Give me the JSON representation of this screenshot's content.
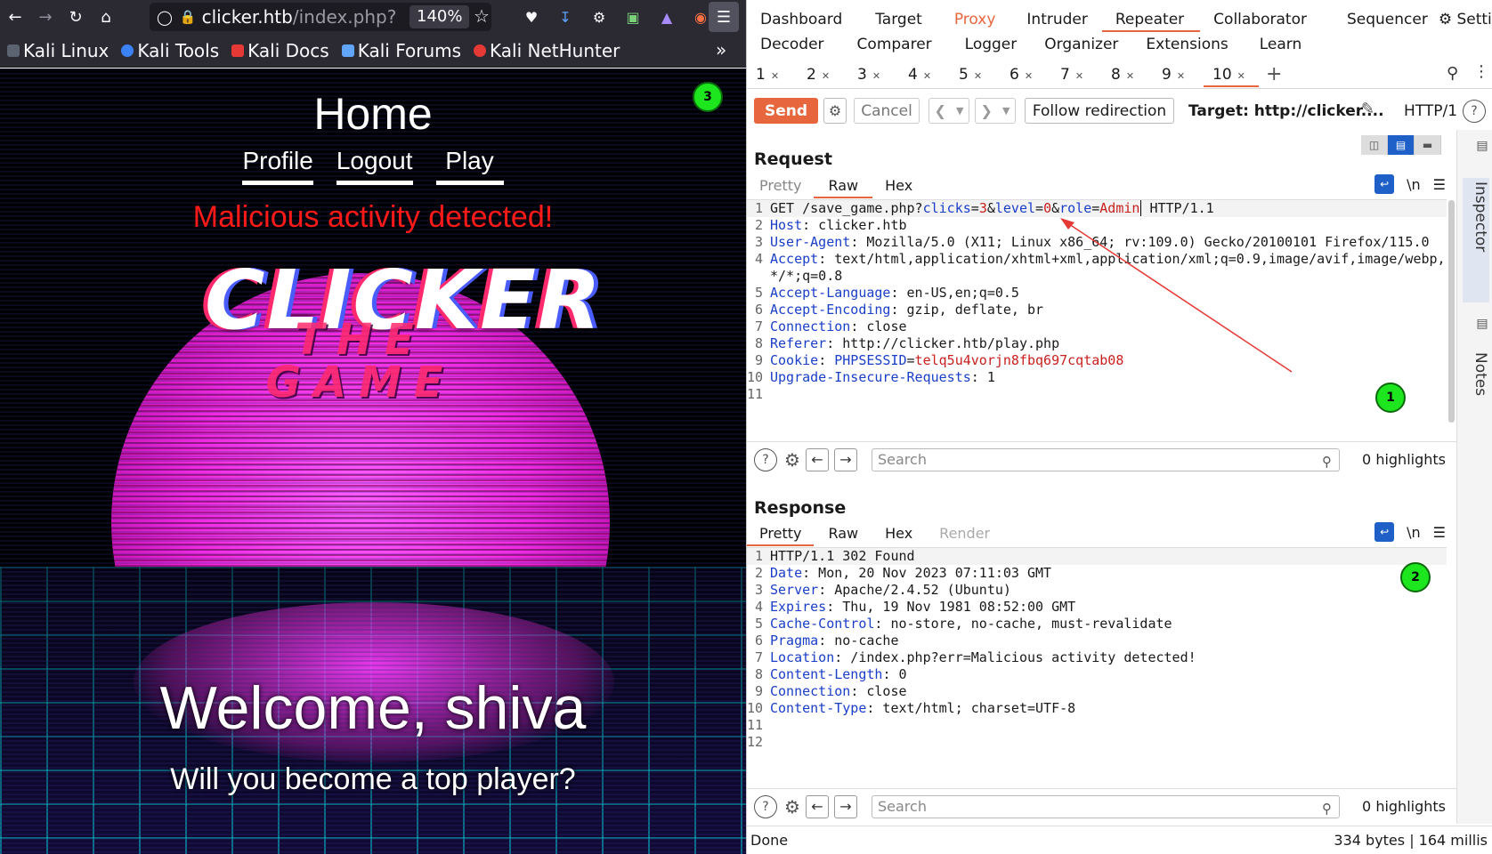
{
  "firefox": {
    "url_host": "clicker.htb",
    "url_path": "/index.php?",
    "zoom": "140%",
    "bookmarks": [
      "Kali Linux",
      "Kali Tools",
      "Kali Docs",
      "Kali Forums",
      "Kali NetHunter"
    ]
  },
  "page": {
    "title": "Home",
    "nav": [
      "Profile",
      "Logout",
      "Play"
    ],
    "error": "Malicious activity detected!",
    "logo_main": "CLICKER",
    "logo_sub": "THE GAME",
    "welcome": "Welcome, shiva",
    "tagline": "Will you become a top player?"
  },
  "markers": [
    "1",
    "2",
    "3"
  ],
  "burp": {
    "tabs_row1": [
      "Dashboard",
      "Target",
      "Proxy",
      "Intruder",
      "Repeater",
      "Collaborator",
      "Sequencer",
      "Settings"
    ],
    "tabs_row2": [
      "Decoder",
      "Comparer",
      "Logger",
      "Organizer",
      "Extensions",
      "Learn"
    ],
    "active_tab": "Repeater",
    "repeater_tabs": [
      "1",
      "2",
      "3",
      "4",
      "5",
      "6",
      "7",
      "8",
      "9",
      "10"
    ],
    "send": "Send",
    "cancel": "Cancel",
    "follow": "Follow redirection",
    "target": "Target: http://clicker....",
    "http": "HTTP/1",
    "request": {
      "title": "Request",
      "tabs": [
        "Pretty",
        "Raw",
        "Hex"
      ],
      "active": "Raw",
      "search_placeholder": "Search",
      "highlights": "0 highlights",
      "lines": [
        {
          "n": "1",
          "method": "GET ",
          "path": "/save_game.php?",
          "params": [
            [
              "clicks",
              "3"
            ],
            [
              "level",
              "0"
            ],
            [
              "role",
              "Admin"
            ]
          ],
          "tail": " HTTP/1.1"
        },
        {
          "n": "2",
          "h": "Host",
          "v": " clicker.htb"
        },
        {
          "n": "3",
          "h": "User-Agent",
          "v": " Mozilla/5.0 (X11; Linux x86_64; rv:109.0) Gecko/20100101 Firefox/115.0"
        },
        {
          "n": "4",
          "h": "Accept",
          "v": " text/html,application/xhtml+xml,application/xml;q=0.9,image/avif,image/webp,*/*;q=0.8"
        },
        {
          "n": "5",
          "h": "Accept-Language",
          "v": " en-US,en;q=0.5"
        },
        {
          "n": "6",
          "h": "Accept-Encoding",
          "v": " gzip, deflate, br"
        },
        {
          "n": "7",
          "h": "Connection",
          "v": " close"
        },
        {
          "n": "8",
          "h": "Referer",
          "v": " http://clicker.htb/play.php"
        },
        {
          "n": "9",
          "h": "Cookie",
          "cn": "PHPSESSID",
          "cv": "telq5u4vorjn8fbq697cqtab08"
        },
        {
          "n": "10",
          "h": "Upgrade-Insecure-Requests",
          "v": " 1"
        },
        {
          "n": "11"
        }
      ]
    },
    "response": {
      "title": "Response",
      "tabs": [
        "Pretty",
        "Raw",
        "Hex",
        "Render"
      ],
      "active": "Pretty",
      "search_placeholder": "Search",
      "highlights": "0 highlights",
      "lines": [
        {
          "n": "1",
          "raw": "HTTP/1.1 302 Found"
        },
        {
          "n": "2",
          "h": "Date",
          "v": " Mon, 20 Nov 2023 07:11:03 GMT"
        },
        {
          "n": "3",
          "h": "Server",
          "v": " Apache/2.4.52 (Ubuntu)"
        },
        {
          "n": "4",
          "h": "Expires",
          "v": " Thu, 19 Nov 1981 08:52:00 GMT"
        },
        {
          "n": "5",
          "h": "Cache-Control",
          "v": " no-store, no-cache, must-revalidate"
        },
        {
          "n": "6",
          "h": "Pragma",
          "v": " no-cache"
        },
        {
          "n": "7",
          "h": "Location",
          "v": " /index.php?err=Malicious activity detected!"
        },
        {
          "n": "8",
          "h": "Content-Length",
          "v": " 0"
        },
        {
          "n": "9",
          "h": "Connection",
          "v": " close"
        },
        {
          "n": "10",
          "h": "Content-Type",
          "v": " text/html; charset=UTF-8"
        },
        {
          "n": "11"
        },
        {
          "n": "12"
        }
      ]
    },
    "side_tabs": [
      "Inspector",
      "Notes"
    ],
    "status_left": "Done",
    "status_right": "334 bytes | 164 millis"
  },
  "colors": {
    "burp_accent": "#e8663d",
    "error_red": "#ff1a1a",
    "marker_green": "#1ee61e"
  }
}
